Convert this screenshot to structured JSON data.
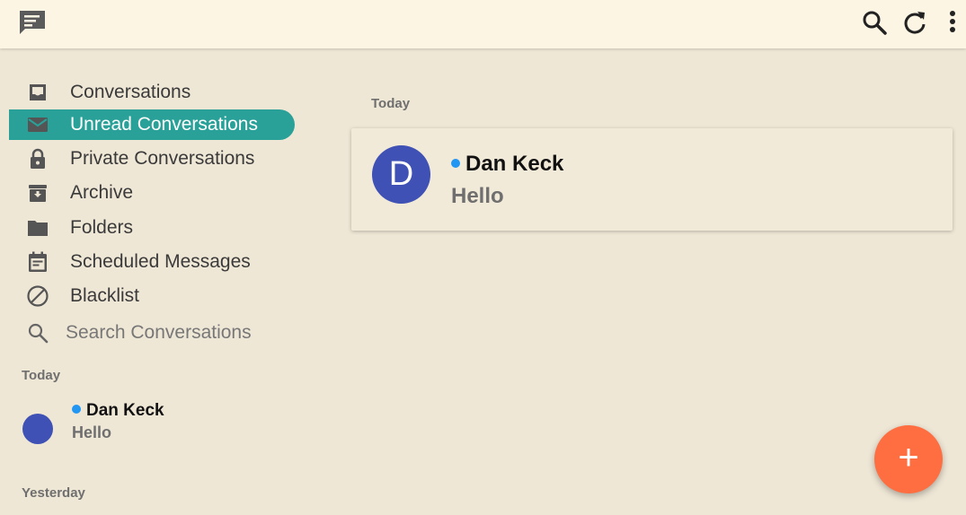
{
  "app": {
    "logo_icon": "chat-logo-icon",
    "toolbar_icons": [
      "search-icon",
      "refresh-icon",
      "more-vert-icon"
    ]
  },
  "sidebar": {
    "items": [
      {
        "label": "Conversations",
        "icon": "inbox-icon",
        "active": false
      },
      {
        "label": "Unread Conversations",
        "icon": "mail-icon",
        "active": true
      },
      {
        "label": "Private Conversations",
        "icon": "lock-icon",
        "active": false
      },
      {
        "label": "Archive",
        "icon": "archive-icon",
        "active": false
      },
      {
        "label": "Folders",
        "icon": "folder-icon",
        "active": false
      },
      {
        "label": "Scheduled Messages",
        "icon": "calendar-icon",
        "active": false
      },
      {
        "label": "Blacklist",
        "icon": "block-icon",
        "active": false
      }
    ],
    "search_label": "Search Conversations",
    "sections": [
      {
        "header": "Today",
        "conversations": [
          {
            "name": "Dan Keck",
            "snippet": "Hello",
            "unread": true
          }
        ]
      },
      {
        "header": "Yesterday",
        "conversations": []
      }
    ]
  },
  "main": {
    "section_header": "Today",
    "conversation": {
      "name": "Dan Keck",
      "snippet": "Hello",
      "avatar_letter": "D",
      "unread": true
    }
  },
  "fab": {
    "label": "+",
    "icon": "plus-icon"
  },
  "colors": {
    "accent": "#2aa198",
    "avatar": "#3f51b5",
    "unread_dot": "#2196f3",
    "fab": "#ff6e40",
    "background": "#efe7d6",
    "toolbar": "#fdf5e3"
  }
}
